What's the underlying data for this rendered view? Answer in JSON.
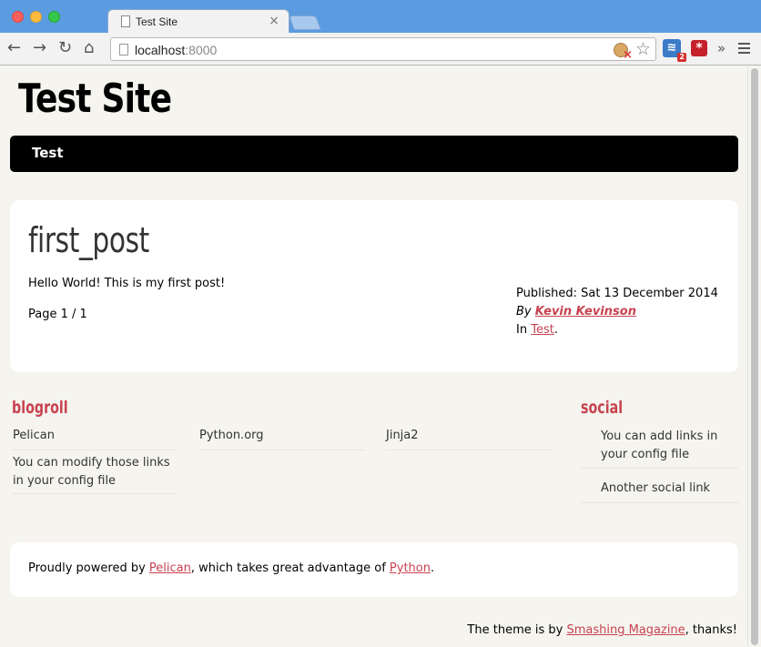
{
  "browser": {
    "tab_title": "Test Site",
    "tab_close": "×",
    "url_host": "localhost",
    "url_port": ":8000",
    "rss_badge": "2",
    "overflow": "»",
    "icons": [
      "back-icon",
      "forward-icon",
      "reload-icon",
      "home-icon",
      "star-icon",
      "rss-extension-icon",
      "lastpass-icon",
      "menu-icon"
    ]
  },
  "site": {
    "title": "Test Site",
    "nav": [
      {
        "label": "Test"
      }
    ]
  },
  "article": {
    "title": "first_post",
    "body": "Hello World! This is my first post!",
    "pagination": "Page 1 / 1",
    "published_label": "Published:",
    "published_date": "Sat 13 December 2014",
    "by_label": "By",
    "author": "Kevin Kevinson",
    "in_label": "In",
    "category": "Test",
    "category_suffix": "."
  },
  "blogroll": {
    "heading": "blogroll",
    "items": [
      {
        "label": "Pelican"
      },
      {
        "label": "Python.org"
      },
      {
        "label": "Jinja2"
      },
      {
        "label": "You can modify those links in your config file"
      }
    ]
  },
  "social": {
    "heading": "social",
    "items": [
      {
        "label": "You can add links in your config file"
      },
      {
        "label": "Another social link"
      }
    ]
  },
  "footer": {
    "powered_prefix": "Proudly powered by",
    "pelican_link": "Pelican",
    "powered_middle": ", which takes great advantage of",
    "python_link": "Python",
    "powered_suffix": ".",
    "theme_prefix": "The theme is by",
    "theme_link": "Smashing Magazine",
    "theme_suffix": ", thanks!"
  },
  "colors": {
    "link": "#c74350",
    "page_bg": "#f5f4ef",
    "navbar_bg": "#000000",
    "chrome_blue": "#5b9be0"
  }
}
